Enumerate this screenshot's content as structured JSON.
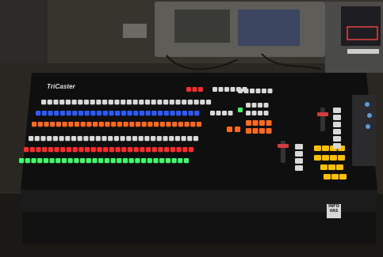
{
  "brand_text": "TriCaster",
  "logo_text": "INFO VAS",
  "bus_colors": {
    "white": "#d9d9d9",
    "blue": "#2a5bff",
    "orange": "#ff6a1a",
    "red": "#ff2b2b",
    "green": "#39ff6a",
    "amber": "#ffc000"
  }
}
